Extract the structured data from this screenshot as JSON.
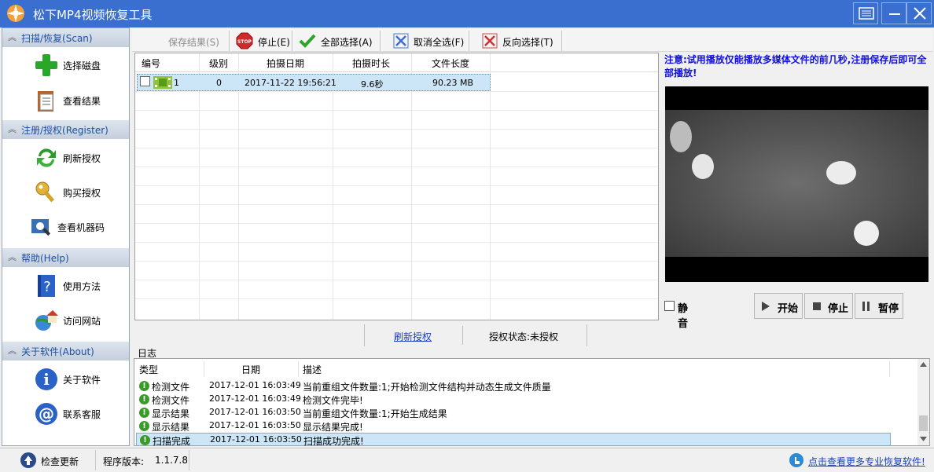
{
  "window": {
    "title": "松下MP4视频恢复工具"
  },
  "sidebar": {
    "sections": [
      {
        "title": "扫描/恢复(Scan)",
        "items": [
          {
            "label": "选择磁盘",
            "icon": "plus-icon"
          },
          {
            "label": "查看结果",
            "icon": "clipboard-icon"
          }
        ]
      },
      {
        "title": "注册/授权(Register)",
        "items": [
          {
            "label": "刷新授权",
            "icon": "refresh-icon"
          },
          {
            "label": "购买授权",
            "icon": "key-icon"
          },
          {
            "label": "查看机器码",
            "icon": "scan-icon"
          }
        ]
      },
      {
        "title": "帮助(Help)",
        "items": [
          {
            "label": "使用方法",
            "icon": "help-book-icon"
          },
          {
            "label": "访问网站",
            "icon": "home-globe-icon"
          }
        ]
      },
      {
        "title": "关于软件(About)",
        "items": [
          {
            "label": "关于软件",
            "icon": "info-icon"
          },
          {
            "label": "联系客服",
            "icon": "at-icon"
          }
        ]
      }
    ]
  },
  "toolbar": {
    "save": "保存结果(S)",
    "stop": "停止(E)",
    "select_all": "全部选择(A)",
    "deselect_all": "取消全选(F)",
    "invert": "反向选择(T)"
  },
  "grid": {
    "headers": [
      "编号",
      "级别",
      "拍摄日期",
      "拍摄时长",
      "文件长度"
    ],
    "rows": [
      {
        "id": "1",
        "level": "0",
        "date": "2017-11-22 19:56:21",
        "duration": "9.6秒",
        "size": "90.23 MB"
      }
    ]
  },
  "preview": {
    "notice": "注意:试用播放仅能播放多媒体文件的前几秒,注册保存后即可全部播放!",
    "mute": "静音",
    "play": "开始",
    "stop": "停止",
    "pause": "暂停"
  },
  "status_mid": {
    "refresh_link": "刷新授权",
    "auth_state": "授权状态:未授权"
  },
  "log": {
    "label": "日志",
    "headers": [
      "类型",
      "日期",
      "描述"
    ],
    "rows": [
      {
        "type": "检测文件",
        "date": "2017-12-01 16:03:49",
        "desc": "当前重组文件数量:1;开始检测文件结构并动态生成文件质量"
      },
      {
        "type": "检测文件",
        "date": "2017-12-01 16:03:49",
        "desc": "检测文件完毕!"
      },
      {
        "type": "显示结果",
        "date": "2017-12-01 16:03:50",
        "desc": "当前重组文件数量:1;开始生成结果"
      },
      {
        "type": "显示结果",
        "date": "2017-12-01 16:03:50",
        "desc": "显示结果完成!"
      },
      {
        "type": "扫描完成",
        "date": "2017-12-01 16:03:50",
        "desc": "扫描成功完成!"
      }
    ]
  },
  "statusbar": {
    "check_update": "检查更新",
    "version_label": "程序版本:",
    "version": "1.1.7.8",
    "more_link": "点击查看更多专业恢复软件!"
  },
  "colors": {
    "titlebar": "#3a6fcf",
    "link": "#1a40c0",
    "notice": "#1010e0",
    "selection": "#cde6f7"
  }
}
